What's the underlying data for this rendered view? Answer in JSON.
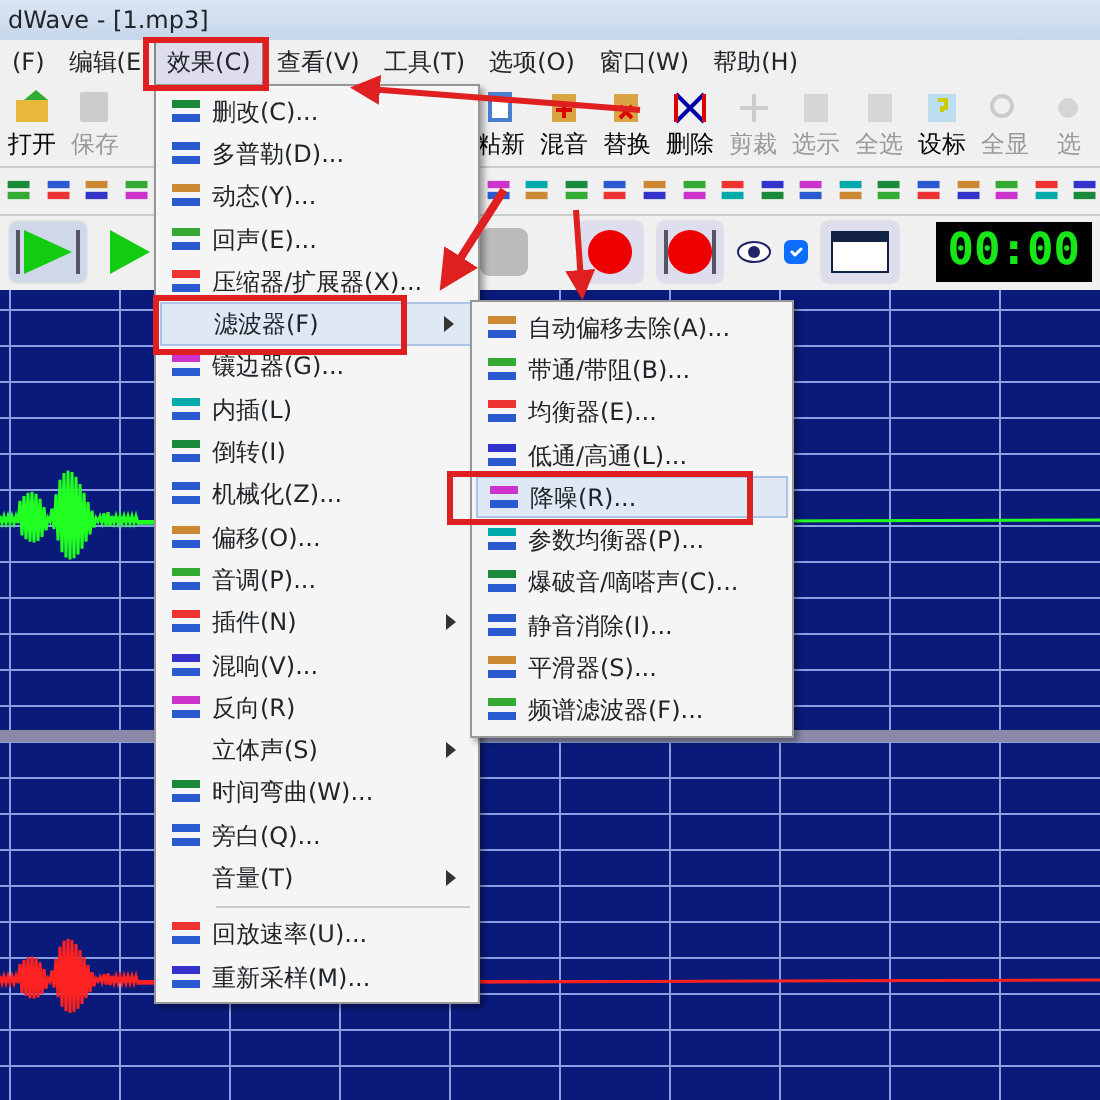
{
  "window": {
    "title": "dWave - [1.mp3]"
  },
  "menu_bar": [
    {
      "label": "(F)",
      "selected": false
    },
    {
      "label": "编辑(E",
      "selected": false
    },
    {
      "label": "效果(C)",
      "selected": true
    },
    {
      "label": "查看(V)",
      "selected": false
    },
    {
      "label": "工具(T)",
      "selected": false
    },
    {
      "label": "选项(O)",
      "selected": false
    },
    {
      "label": "窗口(W)",
      "selected": false
    },
    {
      "label": "帮助(H)",
      "selected": false
    }
  ],
  "toolbar": [
    {
      "label": "打开",
      "disabled": false
    },
    {
      "label": "保存",
      "disabled": true
    },
    {
      "label": "粘新",
      "disabled": false
    },
    {
      "label": "混音",
      "disabled": false
    },
    {
      "label": "替换",
      "disabled": false
    },
    {
      "label": "删除",
      "disabled": false
    },
    {
      "label": "剪裁",
      "disabled": true
    },
    {
      "label": "选示",
      "disabled": true
    },
    {
      "label": "全选",
      "disabled": true
    },
    {
      "label": "设标",
      "disabled": false
    },
    {
      "label": "全显",
      "disabled": true
    },
    {
      "label": "选",
      "disabled": true
    }
  ],
  "transport": {
    "monitor_checkbox": {
      "checked": true
    },
    "timer": "00:00"
  },
  "effects_menu": [
    {
      "kind": "item",
      "label": "删改(C)...",
      "icon": true,
      "selected": false
    },
    {
      "kind": "item",
      "label": "多普勒(D)...",
      "icon": true,
      "selected": false
    },
    {
      "kind": "item",
      "label": "动态(Y)...",
      "icon": true,
      "selected": false
    },
    {
      "kind": "item",
      "label": "回声(E)...",
      "icon": true,
      "selected": false
    },
    {
      "kind": "item",
      "label": "压缩器/扩展器(X)...",
      "icon": true,
      "selected": false
    },
    {
      "kind": "submenu",
      "label": "滤波器(F)",
      "icon": false,
      "selected": true
    },
    {
      "kind": "item",
      "label": "镶边器(G)...",
      "icon": true,
      "selected": false
    },
    {
      "kind": "item",
      "label": "内插(L)",
      "icon": true,
      "selected": false
    },
    {
      "kind": "item",
      "label": "倒转(I)",
      "icon": true,
      "selected": false
    },
    {
      "kind": "item",
      "label": "机械化(Z)...",
      "icon": true,
      "selected": false
    },
    {
      "kind": "item",
      "label": "偏移(O)...",
      "icon": true,
      "selected": false
    },
    {
      "kind": "item",
      "label": "音调(P)...",
      "icon": true,
      "selected": false
    },
    {
      "kind": "submenu",
      "label": "插件(N)",
      "icon": true,
      "selected": false
    },
    {
      "kind": "item",
      "label": "混响(V)...",
      "icon": true,
      "selected": false
    },
    {
      "kind": "item",
      "label": "反向(R)",
      "icon": true,
      "selected": false
    },
    {
      "kind": "submenu",
      "label": "立体声(S)",
      "icon": false,
      "selected": false
    },
    {
      "kind": "item",
      "label": "时间弯曲(W)...",
      "icon": true,
      "selected": false
    },
    {
      "kind": "item",
      "label": "旁白(Q)...",
      "icon": true,
      "selected": false
    },
    {
      "kind": "submenu",
      "label": "音量(T)",
      "icon": false,
      "selected": false
    },
    {
      "kind": "separator"
    },
    {
      "kind": "item",
      "label": "回放速率(U)...",
      "icon": true,
      "selected": false
    },
    {
      "kind": "item",
      "label": "重新采样(M)...",
      "icon": true,
      "selected": false
    }
  ],
  "filter_submenu": [
    {
      "label": "自动偏移去除(A)...",
      "selected": false
    },
    {
      "label": "带通/带阻(B)...",
      "selected": false
    },
    {
      "label": "均衡器(E)...",
      "selected": false
    },
    {
      "label": "低通/高通(L)...",
      "selected": false
    },
    {
      "label": "降噪(R)...",
      "selected": true
    },
    {
      "label": "参数均衡器(P)...",
      "selected": false
    },
    {
      "label": "爆破音/嘀嗒声(C)...",
      "selected": false
    },
    {
      "label": "静音消除(I)...",
      "selected": false
    },
    {
      "label": "平滑器(S)...",
      "selected": false
    },
    {
      "label": "频谱滤波器(F)...",
      "selected": false
    }
  ]
}
